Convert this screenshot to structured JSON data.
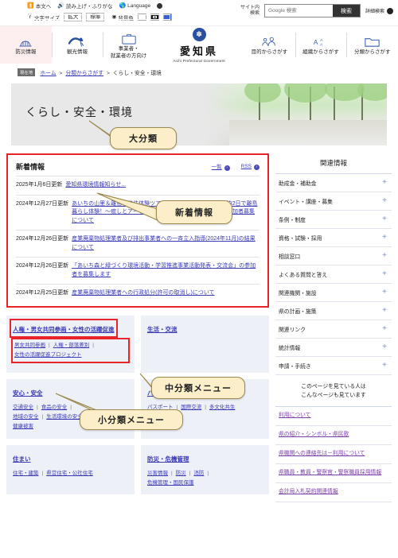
{
  "utility": {
    "skip_link": "本文へ",
    "read_aloud": "読み上げ・ふりがな",
    "language": "Language",
    "fontsize_label": "文字サイズ",
    "fontsize_large": "拡大",
    "fontsize_normal": "標準",
    "bgcolor_label": "背景色",
    "bg_white": "白",
    "bg_black": "黒",
    "bg_blue": "青"
  },
  "search": {
    "label_line1": "サイト内",
    "label_line2": "検索",
    "placeholder": "Google 検索",
    "button": "検索",
    "detail": "詳細検索"
  },
  "gnav": [
    {
      "label": "防災情報",
      "icon": "helmet-icon"
    },
    {
      "label": "観光情報",
      "icon": "tourism-icon"
    },
    {
      "label_line1": "事業者・",
      "label_line2": "就業者の方向け",
      "icon": "briefcase-icon"
    }
  ],
  "brand": {
    "jp": "愛知県",
    "en": "Aichi Prefectural Government",
    "logo": "aichi-logo"
  },
  "gnav_right": [
    {
      "label": "目的からさがす",
      "icon": "people-icon"
    },
    {
      "label": "組織からさがす",
      "icon": "org-icon"
    },
    {
      "label": "分類からさがす",
      "icon": "folder-icon"
    }
  ],
  "breadcrumb": {
    "badge": "現在地",
    "items": [
      {
        "label": "ホーム",
        "link": true
      },
      {
        "label": "分類からさがす",
        "link": true
      },
      {
        "label": "くらし・安全・環境",
        "link": false
      }
    ],
    "separator": ">"
  },
  "hero": {
    "title": "くらし・安全・環境"
  },
  "news": {
    "title": "新着情報",
    "list_link": "一覧",
    "rss_link": "RSS",
    "items": [
      {
        "date": "2025年1月6日更新",
        "title": "愛知県環境情報知らせ..."
      },
      {
        "date": "2024年12月27日更新",
        "title": "あいちの山里＆離島「移住体験ツアー」～あいちの離島編～ 1泊2日で離島暮らし体験！～癒しとアートの島“佐久島”ってこんなところ～ 参加者募集について"
      },
      {
        "date": "2024年12月26日更新",
        "title": "産業廃棄物処理業者及び排出事業者への一斉立入指導(2024年11月)の結果について"
      },
      {
        "date": "2024年12月26日更新",
        "title": "「あいち森と緑づくり環境活動・学習推進事業活動発表・交流会」の参加者を募集します"
      },
      {
        "date": "2024年12月25日更新",
        "title": "産業廃棄物処理業者への行政処分(許可の取消し)について"
      }
    ]
  },
  "categories": [
    {
      "title": "人権・男女共同参画・女性の活躍促進",
      "highlight_title": true,
      "highlight_links": true,
      "links": [
        "男女共同参画",
        "人権・部落差別",
        "女性の活躍促進プロジェクト"
      ]
    },
    {
      "title": "生活・交流",
      "highlight_title": false,
      "highlight_links": false,
      "links": []
    },
    {
      "title": "安心・安全",
      "highlight_title": false,
      "highlight_links": false,
      "links": [
        "交通安全",
        "食品の安全",
        "地域の安全",
        "生活環境の安全",
        "健康被害"
      ]
    },
    {
      "title": "パスポート・国際化・多文化共生",
      "highlight_title": false,
      "highlight_links": false,
      "links": [
        "パスポート",
        "国際交流",
        "多文化共生"
      ]
    },
    {
      "title": "住まい",
      "highlight_title": false,
      "highlight_links": false,
      "links": [
        "住宅・建築",
        "県営住宅・公社住宅"
      ]
    },
    {
      "title": "防災・危機管理",
      "highlight_title": false,
      "highlight_links": false,
      "links": [
        "災害情報",
        "防災",
        "消防",
        "危機管理・国民保護"
      ]
    }
  ],
  "sidebar": {
    "title": "関連情報",
    "items": [
      "助成金・補助金",
      "イベント・講座・募集",
      "条例・制度",
      "資格・試験・採用",
      "相談窓口",
      "よくある質問と答え",
      "関連機関・施設",
      "県の計画・施策",
      "関連リンク",
      "統計情報",
      "申請・手続き"
    ],
    "note_line1": "このページを見ている人は",
    "note_line2": "こんなページも見ています",
    "links": [
      "利用について",
      "県の紹介・シンボル・県民歌",
      "県機関への連絡先は－利用について",
      "県職員・教員・警察官・警察職員採用情報",
      "会計局入札契約関連情報"
    ]
  },
  "callouts": {
    "daibunrui": "大分類",
    "shinchaku": "新着情報",
    "chubunrui": "中分類メニュー",
    "shobunrui": "小分類メニュー"
  },
  "colors": {
    "accent_red": "#e8232a",
    "callout_bg": "#fbeec8",
    "link_blue": "#3b3bb5",
    "link_purple": "#7b3fa8",
    "brand_blue": "#2a4fa0",
    "card_bg": "#eef0f8"
  }
}
